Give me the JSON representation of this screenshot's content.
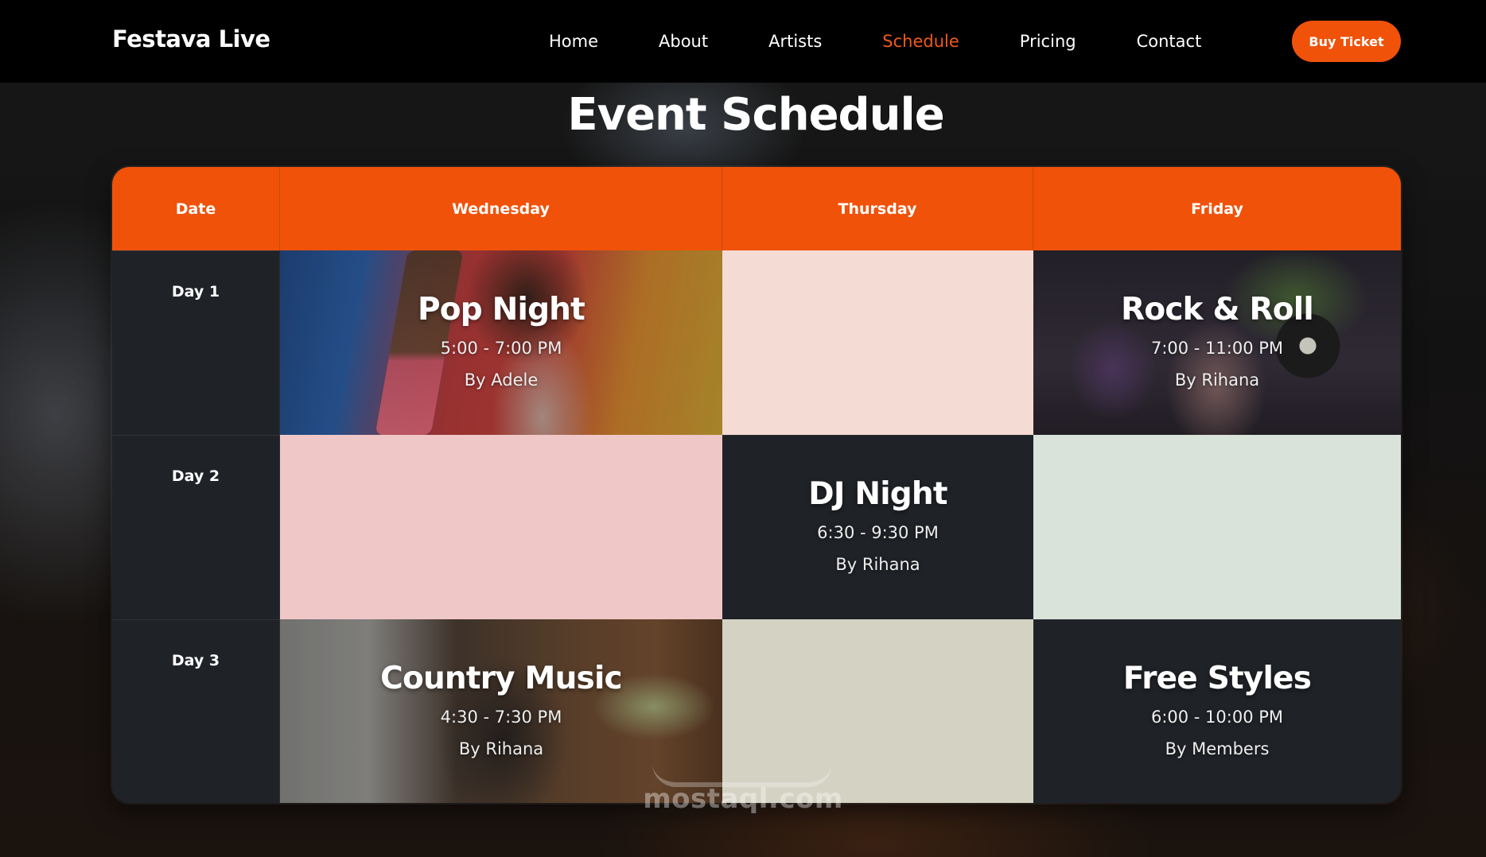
{
  "brand": "Festava Live",
  "nav": {
    "links": [
      "Home",
      "About",
      "Artists",
      "Schedule",
      "Pricing",
      "Contact"
    ],
    "active": "Schedule",
    "buy_label": "Buy Ticket"
  },
  "colors": {
    "accent": "#f0520a",
    "dark_cell": "#1f2227",
    "cell_pink_light": "#f4dbd3",
    "cell_pink": "#efc7c7",
    "cell_mint": "#dae3da",
    "cell_khaki": "#d4d2c2"
  },
  "page_title": "Event Schedule",
  "schedule": {
    "headers": [
      "Date",
      "Wednesday",
      "Thursday",
      "Friday"
    ],
    "rows": [
      {
        "day": "Day 1",
        "wednesday": {
          "title": "Pop Night",
          "time": "5:00 - 7:00 PM",
          "by": "By Adele"
        },
        "thursday": {},
        "friday": {
          "title": "Rock & Roll",
          "time": "7:00 - 11:00 PM",
          "by": "By Rihana"
        }
      },
      {
        "day": "Day 2",
        "wednesday": {},
        "thursday": {
          "title": "DJ Night",
          "time": "6:30 - 9:30 PM",
          "by": "By Rihana"
        },
        "friday": {}
      },
      {
        "day": "Day 3",
        "wednesday": {
          "title": "Country Music",
          "time": "4:30 - 7:30 PM",
          "by": "By Rihana"
        },
        "thursday": {},
        "friday": {
          "title": "Free Styles",
          "time": "6:00 - 10:00 PM",
          "by": "By Members"
        }
      }
    ]
  },
  "watermark": "mostaql.com"
}
